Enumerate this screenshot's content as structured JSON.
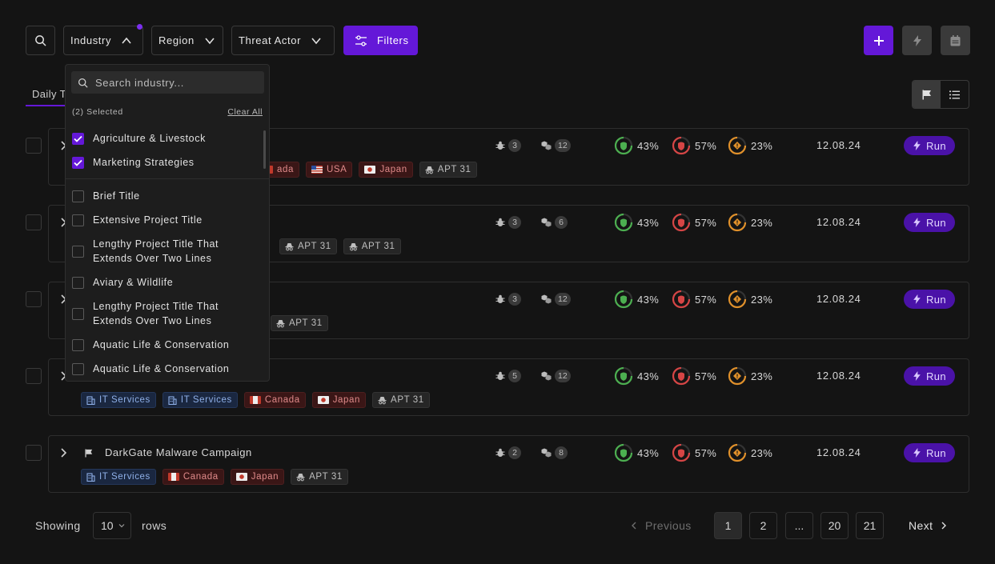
{
  "toolbar": {
    "industry_label": "Industry",
    "region_label": "Region",
    "threat_actor_label": "Threat Actor",
    "filters_label": "Filters",
    "accent_color": "#6418d8"
  },
  "tabs": {
    "daily_label": "Daily T"
  },
  "dropdown": {
    "search_placeholder": "Search industry...",
    "selected_text": "(2) Selected",
    "clear_all": "Clear All",
    "items": [
      {
        "label": "Agriculture & Livestock",
        "checked": true
      },
      {
        "label": "Marketing Strategies",
        "checked": true
      },
      {
        "label": "Brief Title",
        "checked": false
      },
      {
        "label": "Extensive Project Title",
        "checked": false
      },
      {
        "label": "Lengthy Project Title That Extends Over Two Lines",
        "checked": false
      },
      {
        "label": "Aviary & Wildlife",
        "checked": false
      },
      {
        "label": "Lengthy Project Title That Extends Over Two Lines",
        "checked": false
      },
      {
        "label": "Aquatic Life & Conservation",
        "checked": false
      },
      {
        "label": "Aquatic Life & Conservation",
        "checked": false
      }
    ]
  },
  "rows": [
    {
      "title": "",
      "tags": [
        {
          "kind": "reg",
          "flag": "ca",
          "label": "ada"
        },
        {
          "kind": "reg",
          "flag": "us",
          "label": "USA"
        },
        {
          "kind": "reg",
          "flag": "jp",
          "label": "Japan"
        },
        {
          "kind": "ta",
          "label": "APT 31"
        }
      ],
      "bugs": "3",
      "cubes": "12",
      "g1": "43%",
      "g2": "57%",
      "g3": "23%",
      "date": "12.08.24",
      "run": "Run"
    },
    {
      "title": "",
      "tags": [
        {
          "kind": "ta",
          "label": "APT 31"
        },
        {
          "kind": "ta",
          "label": "APT 31"
        }
      ],
      "bugs": "3",
      "cubes": "6",
      "g1": "43%",
      "g2": "57%",
      "g3": "23%",
      "date": "12.08.24",
      "run": "Run"
    },
    {
      "title": "",
      "tags": [
        {
          "kind": "ta",
          "label": "APT 31"
        }
      ],
      "bugs": "3",
      "cubes": "12",
      "g1": "43%",
      "g2": "57%",
      "g3": "23%",
      "date": "12.08.24",
      "run": "Run"
    },
    {
      "title": "",
      "tags": [
        {
          "kind": "ind",
          "label": "IT Services"
        },
        {
          "kind": "ind",
          "label": "IT Services"
        },
        {
          "kind": "reg",
          "flag": "ca",
          "label": "Canada"
        },
        {
          "kind": "reg",
          "flag": "jp",
          "label": "Japan"
        },
        {
          "kind": "ta",
          "label": "APT 31"
        }
      ],
      "bugs": "5",
      "cubes": "12",
      "g1": "43%",
      "g2": "57%",
      "g3": "23%",
      "date": "12.08.24",
      "run": "Run"
    },
    {
      "title": "DarkGate Malware Campaign",
      "tags": [
        {
          "kind": "ind",
          "label": "IT Services"
        },
        {
          "kind": "reg",
          "flag": "ca",
          "label": "Canada"
        },
        {
          "kind": "reg",
          "flag": "jp",
          "label": "Japan"
        },
        {
          "kind": "ta",
          "label": "APT 31"
        }
      ],
      "bugs": "2",
      "cubes": "8",
      "g1": "43%",
      "g2": "57%",
      "g3": "23%",
      "date": "12.08.24",
      "run": "Run"
    }
  ],
  "pagination": {
    "showing": "Showing",
    "rows_value": "10",
    "rows": "rows",
    "previous": "Previous",
    "next": "Next",
    "pages": [
      "1",
      "2",
      "...",
      "20",
      "21"
    ],
    "current": "1"
  },
  "colors": {
    "gauge_green": "#4caf50",
    "gauge_red": "#d64545",
    "gauge_orange": "#e0902a"
  }
}
